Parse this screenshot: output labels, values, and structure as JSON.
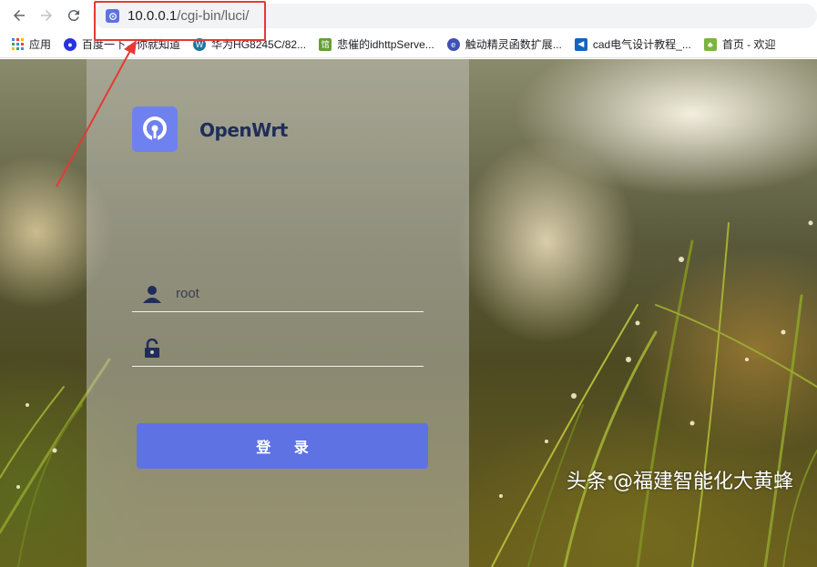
{
  "browser": {
    "url_host": "10.0.0.1",
    "url_path": "/cgi-bin/luci/",
    "bookmarks": [
      {
        "label": "应用",
        "color": "#4285f4"
      },
      {
        "label": "百度一下，你就知道",
        "color": "#2932e1"
      },
      {
        "label": "华为HG8245C/82...",
        "color": "#21759b"
      },
      {
        "label": "悲催的idhttpServe...",
        "color": "#8bc34a"
      },
      {
        "label": "触动精灵函数扩展...",
        "color": "#3f51b5"
      },
      {
        "label": "cad电气设计教程_...",
        "color": "#1565c0"
      },
      {
        "label": "首页 - 欢迎",
        "color": "#7cb342"
      }
    ]
  },
  "login": {
    "brand": "OpenWrt",
    "username_value": "root",
    "password_value": "",
    "submit_label": "登 录",
    "accent": "#5e72e4"
  },
  "watermark": "头条 @福建智能化大黄蜂"
}
